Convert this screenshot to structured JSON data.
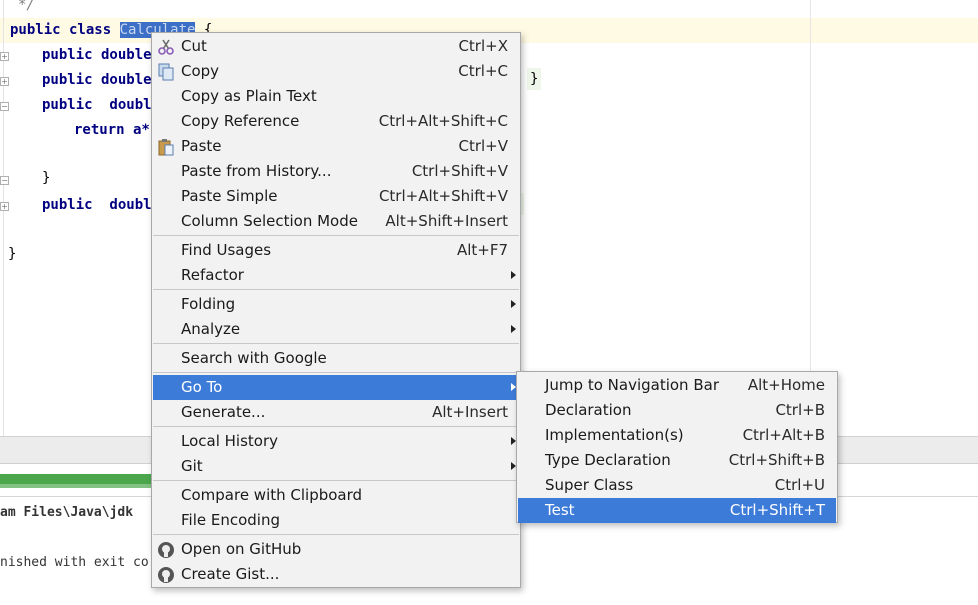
{
  "editor": {
    "lines": {
      "comment_end": "*/",
      "class_kw": "public class ",
      "class_name": "Calculate",
      "class_brace": " {",
      "l2": "public double",
      "l3": "public double",
      "l4": "public  doubl",
      "l5_return": "return a*",
      "l6_close": "}",
      "l7": "public  doubl",
      "l8_close": "}",
      "brace_right": "}"
    }
  },
  "console": {
    "path_text": "am Files\\Java\\jdk",
    "finish_text": "nished with exit co"
  },
  "context_menu": {
    "items": [
      {
        "label": "Cut",
        "shortcut": "Ctrl+X",
        "icon": "scissors-icon"
      },
      {
        "label": "Copy",
        "shortcut": "Ctrl+C",
        "icon": "copy-icon"
      },
      {
        "label": "Copy as Plain Text",
        "shortcut": ""
      },
      {
        "label": "Copy Reference",
        "shortcut": "Ctrl+Alt+Shift+C"
      },
      {
        "label": "Paste",
        "shortcut": "Ctrl+V",
        "icon": "paste-icon"
      },
      {
        "label": "Paste from History...",
        "shortcut": "Ctrl+Shift+V"
      },
      {
        "label": "Paste Simple",
        "shortcut": "Ctrl+Alt+Shift+V"
      },
      {
        "label": "Column Selection Mode",
        "shortcut": "Alt+Shift+Insert"
      },
      {
        "label": "Find Usages",
        "shortcut": "Alt+F7"
      },
      {
        "label": "Refactor",
        "submenu": true
      },
      {
        "label": "Folding",
        "submenu": true
      },
      {
        "label": "Analyze",
        "submenu": true
      },
      {
        "label": "Search with Google",
        "shortcut": ""
      },
      {
        "label": "Go To",
        "submenu": true,
        "highlighted": true
      },
      {
        "label": "Generate...",
        "shortcut": "Alt+Insert"
      },
      {
        "label": "Local History",
        "submenu": true
      },
      {
        "label": "Git",
        "submenu": true
      },
      {
        "label": "Compare with Clipboard",
        "shortcut": ""
      },
      {
        "label": "File Encoding",
        "shortcut": ""
      },
      {
        "label": "Open on GitHub",
        "icon": "github-icon"
      },
      {
        "label": "Create Gist...",
        "icon": "github-icon"
      }
    ]
  },
  "goto_submenu": {
    "items": [
      {
        "label": "Jump to Navigation Bar",
        "shortcut": "Alt+Home"
      },
      {
        "label": "Declaration",
        "shortcut": "Ctrl+B"
      },
      {
        "label": "Implementation(s)",
        "shortcut": "Ctrl+Alt+B"
      },
      {
        "label": "Type Declaration",
        "shortcut": "Ctrl+Shift+B"
      },
      {
        "label": "Super Class",
        "shortcut": "Ctrl+U"
      },
      {
        "label": "Test",
        "shortcut": "Ctrl+Shift+T",
        "highlighted": true
      }
    ]
  },
  "colors": {
    "menu_highlight": "#3d7bd8",
    "selection": "#3d6fc7",
    "keyword": "#000080",
    "caret_row": "#fffae3"
  }
}
